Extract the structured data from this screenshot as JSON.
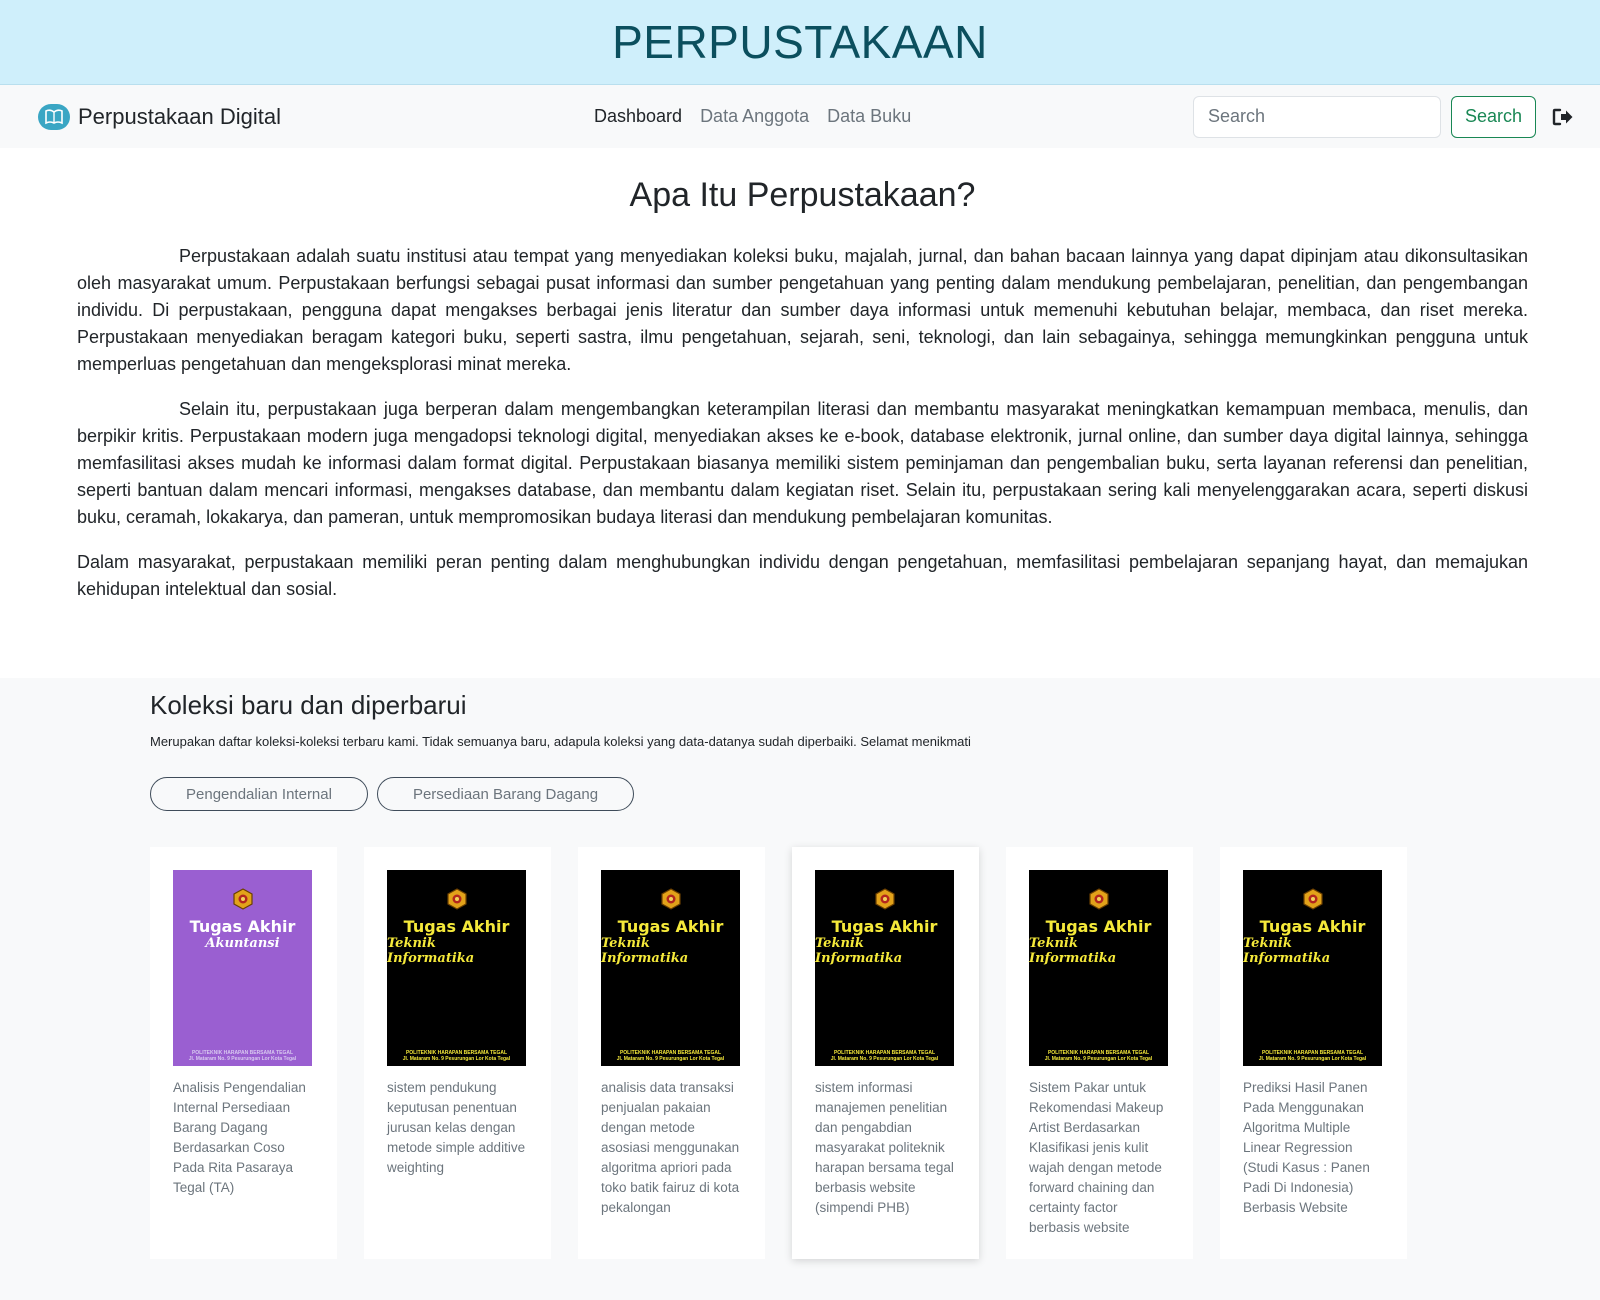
{
  "banner": {
    "title": "PERPUSTAKAAN"
  },
  "navbar": {
    "brand": "Perpustakaan Digital",
    "links": [
      {
        "label": "Dashboard",
        "active": true
      },
      {
        "label": "Data Anggota",
        "active": false
      },
      {
        "label": "Data Buku",
        "active": false
      }
    ],
    "search_placeholder": "Search",
    "search_value": "",
    "search_button": "Search",
    "logout_icon": "logout-icon"
  },
  "about": {
    "heading": "Apa Itu Perpustakaan?",
    "paragraphs": [
      "Perpustakaan adalah suatu institusi atau tempat yang menyediakan koleksi buku, majalah, jurnal, dan bahan bacaan lainnya yang dapat dipinjam atau dikonsultasikan oleh masyarakat umum. Perpustakaan berfungsi sebagai pusat informasi dan sumber pengetahuan yang penting dalam mendukung pembelajaran, penelitian, dan pengembangan individu. Di perpustakaan, pengguna dapat mengakses berbagai jenis literatur dan sumber daya informasi untuk memenuhi kebutuhan belajar, membaca, dan riset mereka. Perpustakaan menyediakan beragam kategori buku, seperti sastra, ilmu pengetahuan, sejarah, seni, teknologi, dan lain sebagainya, sehingga memungkinkan pengguna untuk memperluas pengetahuan dan mengeksplorasi minat mereka.",
      "Selain itu, perpustakaan juga berperan dalam mengembangkan keterampilan literasi dan membantu masyarakat meningkatkan kemampuan membaca, menulis, dan berpikir kritis. Perpustakaan modern juga mengadopsi teknologi digital, menyediakan akses ke e-book, database elektronik, jurnal online, dan sumber daya digital lainnya, sehingga memfasilitasi akses mudah ke informasi dalam format digital. Perpustakaan biasanya memiliki sistem peminjaman dan pengembalian buku, serta layanan referensi dan penelitian, seperti bantuan dalam mencari informasi, mengakses database, dan membantu dalam kegiatan riset. Selain itu, perpustakaan sering kali menyelenggarakan acara, seperti diskusi buku, ceramah, lokakarya, dan pameran, untuk mempromosikan budaya literasi dan mendukung pembelajaran komunitas.",
      "Dalam masyarakat, perpustakaan memiliki peran penting dalam menghubungkan individu dengan pengetahuan, memfasilitasi pembelajaran sepanjang hayat, dan memajukan kehidupan intelektual dan sosial."
    ]
  },
  "koleksi": {
    "heading": "Koleksi baru dan diperbarui",
    "description": "Merupakan daftar koleksi-koleksi terbaru kami. Tidak semuanya baru, adapula koleksi yang data-datanya sudah diperbaiki. Selamat menikmati",
    "filters": [
      "Pengendalian Internal",
      "Persediaan Barang Dagang"
    ],
    "books": [
      {
        "cover_title": "Tugas Akhir",
        "cover_subtitle": "Akuntansi",
        "cover_color": "#9a5fd1",
        "cover_footer": "POLITEKNIK HARAPAN BERSAMA TEGAL\nJl. Mataram No. 9 Pesurungan Lor Kota Tegal",
        "title": "Analisis Pengendalian Internal Persediaan Barang Dagang Berdasarkan Coso Pada Rita Pasaraya Tegal (TA)"
      },
      {
        "cover_title": "Tugas Akhir",
        "cover_subtitle": "Teknik Informatika",
        "cover_color": "#000000",
        "cover_footer": "POLITEKNIK HARAPAN BERSAMA TEGAL\nJl. Mataram No. 9 Pesurungan Lor Kota Tegal",
        "title": "sistem pendukung keputusan penentuan jurusan kelas dengan metode simple additive weighting"
      },
      {
        "cover_title": "Tugas Akhir",
        "cover_subtitle": "Teknik Informatika",
        "cover_color": "#000000",
        "cover_footer": "POLITEKNIK HARAPAN BERSAMA TEGAL\nJl. Mataram No. 9 Pesurungan Lor Kota Tegal",
        "title": "analisis data transaksi penjualan pakaian dengan metode asosiasi menggunakan algoritma apriori pada toko batik fairuz di kota pekalongan"
      },
      {
        "cover_title": "Tugas Akhir",
        "cover_subtitle": "Teknik Informatika",
        "cover_color": "#000000",
        "cover_footer": "POLITEKNIK HARAPAN BERSAMA TEGAL\nJl. Mataram No. 9 Pesurungan Lor Kota Tegal",
        "title": "sistem informasi manajemen penelitian dan pengabdian masyarakat politeknik harapan bersama tegal berbasis website (simpendi PHB)"
      },
      {
        "cover_title": "Tugas Akhir",
        "cover_subtitle": "Teknik Informatika",
        "cover_color": "#000000",
        "cover_footer": "POLITEKNIK HARAPAN BERSAMA TEGAL\nJl. Mataram No. 9 Pesurungan Lor Kota Tegal",
        "title": "Sistem Pakar untuk Rekomendasi Makeup Artist Berdasarkan Klasifikasi jenis kulit wajah dengan metode forward chaining dan certainty factor berbasis website"
      },
      {
        "cover_title": "Tugas Akhir",
        "cover_subtitle": "Teknik Informatika",
        "cover_color": "#000000",
        "cover_footer": "POLITEKNIK HARAPAN BERSAMA TEGAL\nJl. Mataram No. 9 Pesurungan Lor Kota Tegal",
        "title": "Prediksi Hasil Panen Pada Menggunakan Algoritma Multiple Linear Regression (Studi Kasus : Panen Padi Di Indonesia) Berbasis Website"
      }
    ]
  },
  "colors": {
    "banner_bg": "#cfeffb",
    "banner_text": "#0b4f5e",
    "accent_green": "#198754",
    "brand_icon": "#3aa6c4"
  }
}
